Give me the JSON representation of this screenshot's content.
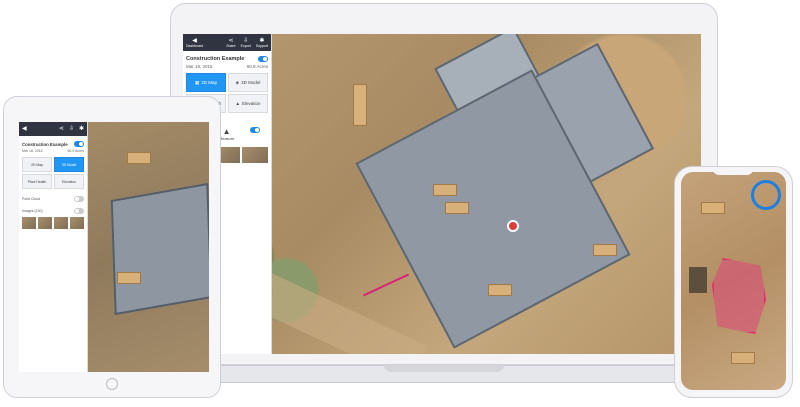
{
  "laptop_app": {
    "toolbar": {
      "dashboard_label": "Dashboard",
      "share_label": "Share",
      "export_label": "Export",
      "support_label": "Support"
    },
    "project": {
      "name": "Construction Example",
      "date": "Mar 18, 2016",
      "area": "60.9 Acres"
    },
    "modes": [
      "2D Map",
      "3D Model",
      "Point Health",
      "Elevation"
    ],
    "active_mode": "2D Map",
    "tools": [
      "Point",
      "Measure"
    ],
    "map": {
      "marker_color": "#e23b3b",
      "measure_color": "#d6247a"
    }
  },
  "tablet_app": {
    "project": {
      "name": "Construction Example",
      "date": "Mar 18, 2016",
      "area": "60.9 Acres"
    },
    "modes": [
      "2D Map",
      "3D Model",
      "Plant Health",
      "Elevation"
    ],
    "active_mode": "3D Model",
    "options": [
      "Point Cloud",
      "Images (130)"
    ]
  },
  "phone_app": {
    "accent": "#1f7fe0",
    "highlight": "#e0306c"
  }
}
